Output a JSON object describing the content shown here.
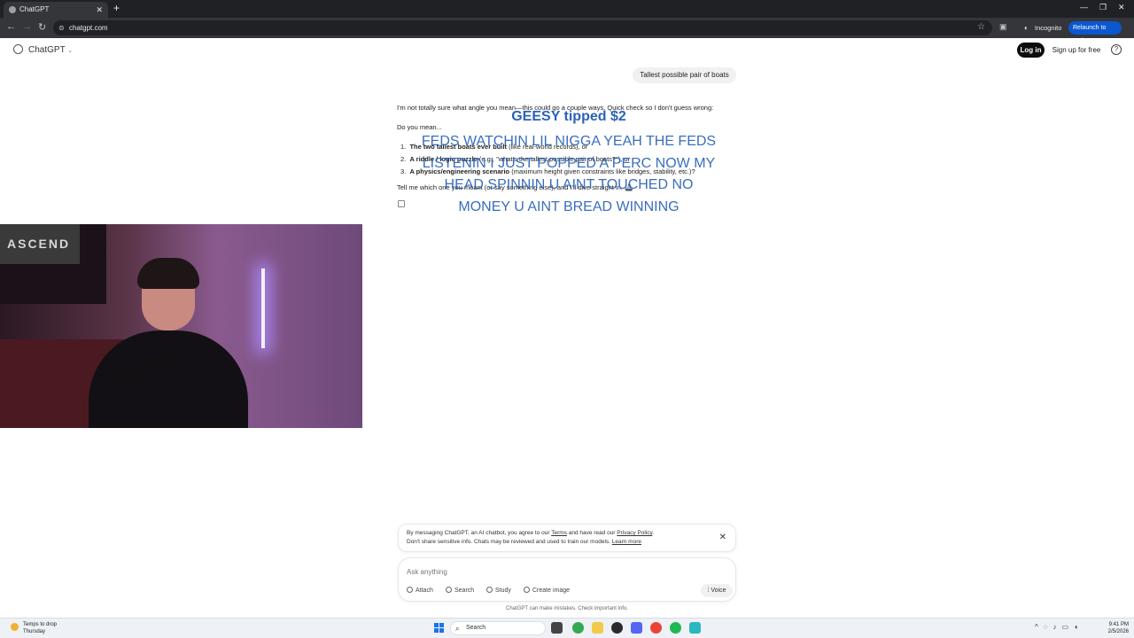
{
  "browser": {
    "tab_title": "ChatGPT",
    "url": "chatgpt.com",
    "incognito_label": "Incognito",
    "relaunch_label": "Relaunch to update"
  },
  "header": {
    "brand": "ChatGPT",
    "login_label": "Log in",
    "signup_label": "Sign up for free",
    "help_label": "?"
  },
  "conversation": {
    "user_message": "Tallest possible pair of boats",
    "assistant": {
      "intro": "I'm not totally sure what angle you mean—this could go a couple ways. Quick check so I don't guess wrong:",
      "question": "Do you mean...",
      "options": [
        {
          "num": "1.",
          "bold": "The two tallest boats ever built",
          "rest": " (like real-world records), or"
        },
        {
          "num": "2.",
          "bold": "A riddle / logic puzzle",
          "rest": " (e.g., \"what's the tallest possible pair of boats?\"), or"
        },
        {
          "num": "3.",
          "bold": "A physics/engineering scenario",
          "rest": " (maximum height given constraints like bridges, stability, etc.)?"
        }
      ],
      "closing": "Tell me which one you meant (or say something else), and I'll dive straight in. 🚢"
    }
  },
  "overlay": {
    "tip": "GEESY tipped $2",
    "lines": [
      "FEDS WATCHIN LIL NIGGA YEAH THE FEDS",
      "LISTENIN I JUST POPPED A PERC NOW MY",
      "HEAD SPINNIN U AINT TOUCHED NO",
      "MONEY U AINT BREAD WINNING"
    ]
  },
  "webcam": {
    "flag_text": "ASCEND"
  },
  "notice": {
    "line1_pre": "By messaging ChatGPT, an AI chatbot, you agree to our ",
    "terms": "Terms",
    "line1_mid": " and have read our ",
    "privacy": "Privacy Policy",
    "line1_end": ".",
    "line2_pre": "Don't share sensitive info. Chats may be reviewed and used to train our models. ",
    "learn_more": "Learn more"
  },
  "composer": {
    "placeholder": "Ask anything",
    "tools": [
      "Attach",
      "Search",
      "Study",
      "Create image"
    ],
    "voice_label": "Voice",
    "disclaimer": "ChatGPT can make mistakes. Check important info."
  },
  "taskbar": {
    "weather_line1": "Temps to drop",
    "weather_line2": "Thursday",
    "search_label": "Search",
    "time": "9:41 PM",
    "date": "2/5/2026"
  }
}
